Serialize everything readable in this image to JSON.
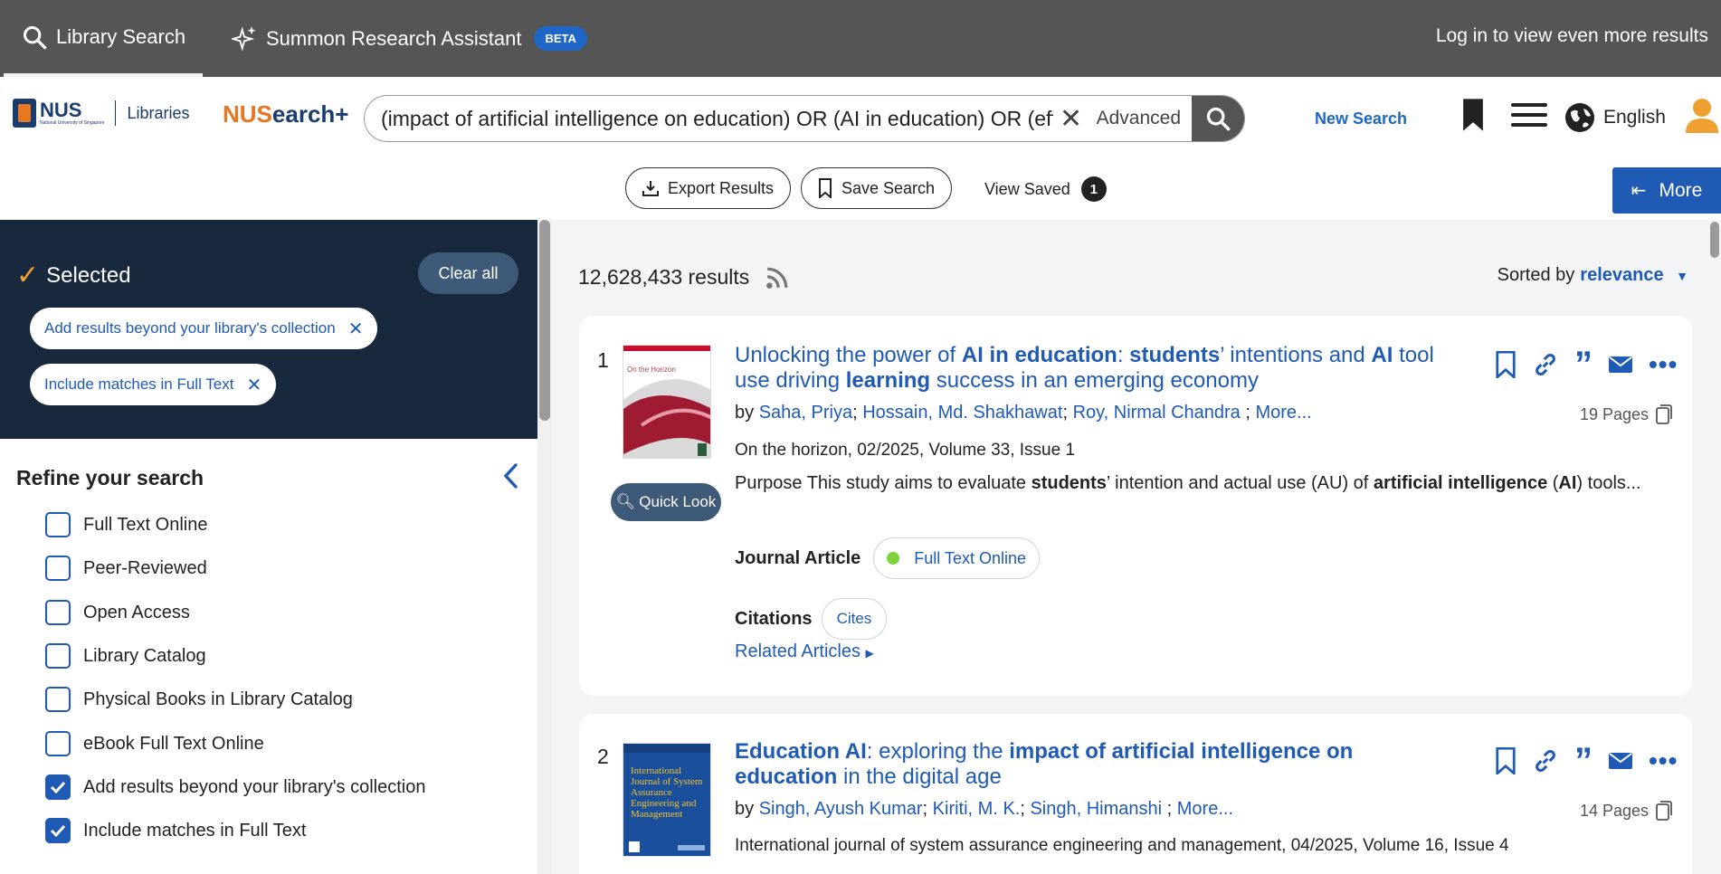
{
  "topbar": {
    "tab_library_search": "Library Search",
    "tab_summon": "Summon Research Assistant",
    "beta": "BETA",
    "login": "Log in to view even more results"
  },
  "header": {
    "nus_short": "NUS",
    "nus_full": "National University of Singapore",
    "libraries": "Libraries",
    "nusearch_a": "NUS",
    "nusearch_b": "earch+",
    "search_query": "(impact of artificial intelligence on education) OR (AI in education) OR (eff",
    "advanced": "Advanced",
    "new_search": "New Search",
    "language": "English"
  },
  "toolbar": {
    "export": "Export Results",
    "save": "Save Search",
    "view_saved": "View Saved",
    "saved_count": "1",
    "more": "More"
  },
  "sidebar": {
    "selected_title": "Selected",
    "clear_all": "Clear all",
    "chips": [
      "Add results beyond your library's collection",
      "Include matches in Full Text"
    ],
    "refine_title": "Refine your search",
    "facets": [
      {
        "label": "Full Text Online",
        "checked": false
      },
      {
        "label": "Peer-Reviewed",
        "checked": false
      },
      {
        "label": "Open Access",
        "checked": false
      },
      {
        "label": "Library Catalog",
        "checked": false
      },
      {
        "label": "Physical Books in Library Catalog",
        "checked": false
      },
      {
        "label": "eBook Full Text Online",
        "checked": false
      },
      {
        "label": "Add results beyond your library's collection",
        "checked": true
      },
      {
        "label": "Include matches in Full Text",
        "checked": true
      }
    ]
  },
  "results": {
    "count": "12,628,433 results",
    "sorted_by": "Sorted by",
    "sort_value": "relevance",
    "items": [
      {
        "number": "1",
        "thumb_text": "On the Horizon",
        "quick_look": "Quick Look",
        "title_parts": [
          {
            "t": "Unlocking the power of ",
            "b": false
          },
          {
            "t": "AI in education",
            "b": true
          },
          {
            "t": ": ",
            "b": false
          },
          {
            "t": "students",
            "b": true
          },
          {
            "t": "’ intentions and ",
            "b": false
          },
          {
            "t": "AI",
            "b": true
          },
          {
            "t": " tool use driving ",
            "b": false
          },
          {
            "t": "learning",
            "b": true
          },
          {
            "t": " success in an emerging economy",
            "b": false
          }
        ],
        "by": "by ",
        "authors": [
          "Saha, Priya",
          "Hossain, Md. Shakhawat",
          "Roy, Nirmal Chandra"
        ],
        "more_authors": "More...",
        "publication": "On the horizon, 02/2025, Volume 33, Issue 1",
        "abstract_parts": [
          {
            "t": "Purpose This study aims to evaluate ",
            "b": false
          },
          {
            "t": "students",
            "b": true
          },
          {
            "t": "’ intention and actual use (AU) of ",
            "b": false
          },
          {
            "t": "artificial intelligence",
            "b": true
          },
          {
            "t": " (",
            "b": false
          },
          {
            "t": "AI",
            "b": true
          },
          {
            "t": ") tools...",
            "b": false
          }
        ],
        "content_type": "Journal Article",
        "availability": "Full Text Online",
        "citations_label": "Citations",
        "cites": "Cites",
        "related": "Related Articles",
        "pages": "19 Pages"
      },
      {
        "number": "2",
        "thumb_text": "International Journal of System Assurance Engineering and Management",
        "title_parts": [
          {
            "t": "Education AI",
            "b": true
          },
          {
            "t": ": exploring the ",
            "b": false
          },
          {
            "t": "impact of artificial intelligence on education",
            "b": true
          },
          {
            "t": " in the digital age",
            "b": false
          }
        ],
        "by": "by ",
        "authors": [
          "Singh, Ayush Kumar",
          "Kiriti, M. K.",
          "Singh, Himanshi"
        ],
        "more_authors": "More...",
        "publication": "International journal of system assurance engineering and management, 04/2025, Volume 16, Issue 4",
        "pages": "14 Pages"
      }
    ]
  },
  "colors": {
    "topbar": "#555555",
    "brand_blue": "#1f5ab5",
    "sidebar_dark": "#18293e",
    "accent_orange": "#e87722",
    "available_green": "#7dd33b"
  }
}
